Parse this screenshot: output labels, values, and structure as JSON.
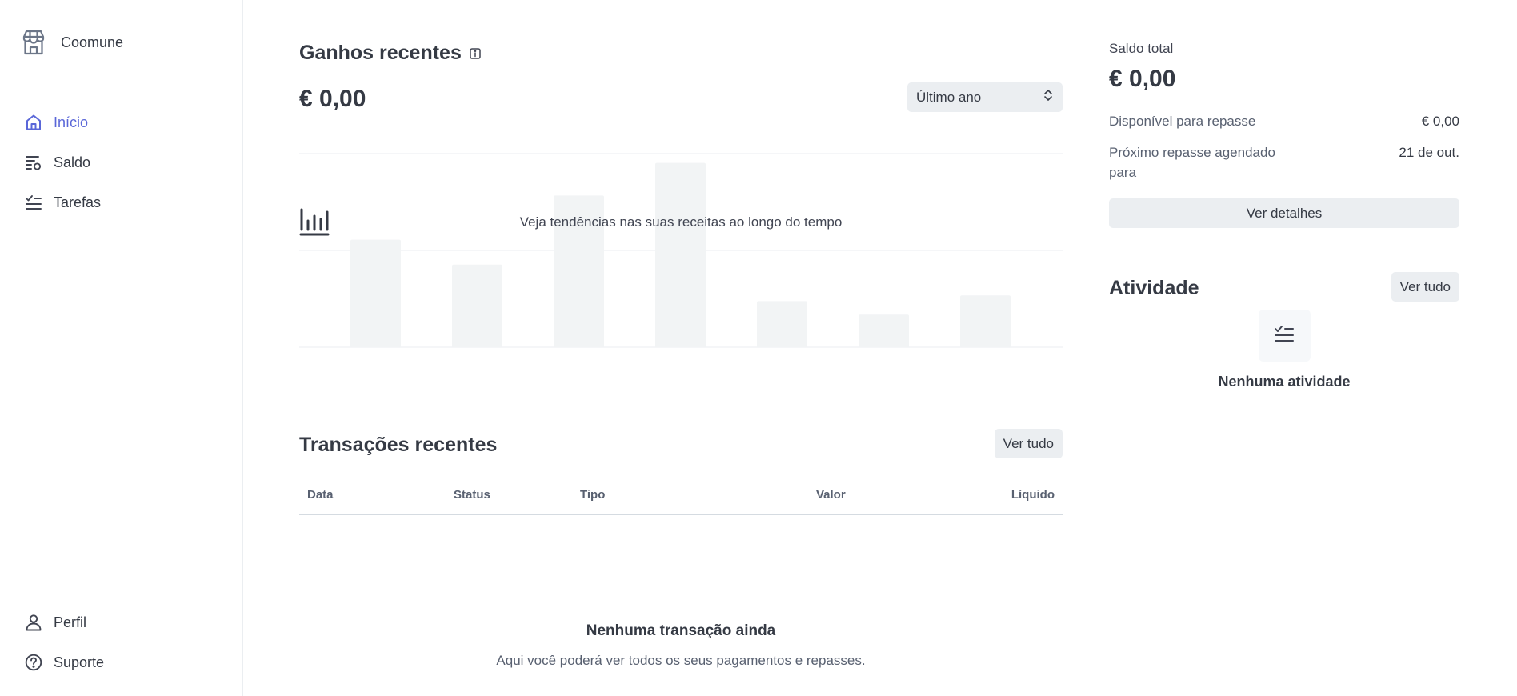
{
  "app": {
    "name": "Coomune"
  },
  "sidebar": {
    "items": [
      {
        "label": "Início",
        "icon": "home-icon",
        "active": true
      },
      {
        "label": "Saldo",
        "icon": "balance-icon",
        "active": false
      },
      {
        "label": "Tarefas",
        "icon": "tasks-icon",
        "active": false
      }
    ],
    "bottom_items": [
      {
        "label": "Perfil",
        "icon": "user-icon"
      },
      {
        "label": "Suporte",
        "icon": "help-icon"
      }
    ]
  },
  "earnings": {
    "title": "Ganhos recentes",
    "amount": "€ 0,00",
    "period": "Último ano",
    "empty_message": "Veja tendências nas suas receitas ao longo do tempo"
  },
  "chart_data": {
    "type": "bar",
    "placeholder": true,
    "categories": [],
    "values": [
      0.56,
      0.43,
      0.79,
      0.96,
      0.24,
      0.17,
      0.27
    ],
    "title": "",
    "xlabel": "",
    "ylabel": "",
    "ylim": [
      0,
      1
    ],
    "grid": true,
    "colors": {
      "bar": "#f2f4f5",
      "grid": "#ebeef1"
    }
  },
  "transactions": {
    "title": "Transações recentes",
    "view_all": "Ver tudo",
    "columns": [
      "Data",
      "Status",
      "Tipo",
      "Valor",
      "Líquido"
    ],
    "empty_title": "Nenhuma transação ainda",
    "empty_subtitle": "Aqui você poderá ver todos os seus pagamentos e repasses."
  },
  "balance": {
    "label": "Saldo total",
    "amount": "€ 0,00",
    "available_label": "Disponível para repasse",
    "available_value": "€ 0,00",
    "next_payout_label": "Próximo repasse agendado para",
    "next_payout_value": "21 de out.",
    "details_button": "Ver detalhes"
  },
  "activity": {
    "title": "Atividade",
    "view_all": "Ver tudo",
    "empty_title": "Nenhuma atividade"
  },
  "colors": {
    "accent": "#5a67d8",
    "text": "#353a44",
    "muted": "#596171",
    "button_bg": "#ebeef1"
  }
}
